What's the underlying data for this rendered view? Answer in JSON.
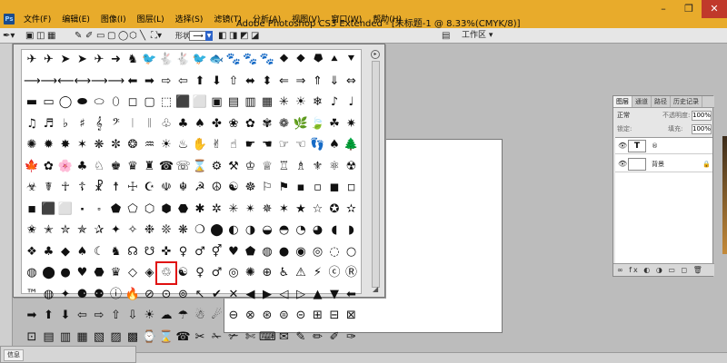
{
  "window": {
    "title": "Adobe Photoshop CS3 Extended - [未标题-1 @ 8.33%(CMYK/8)]",
    "app_icon_label": "Ps",
    "minimize": "–",
    "restore": "❐",
    "close": "✕"
  },
  "menu": [
    "文件(F)",
    "编辑(E)",
    "图像(I)",
    "图层(L)",
    "选择(S)",
    "滤镜(T)",
    "分析(A)",
    "视图(V)",
    "窗口(W)",
    "帮助(H)"
  ],
  "options_bar": {
    "style_label": "形状:",
    "style_value": "⟶",
    "workspace_label": "工作区 ▾"
  },
  "shape_picker": {
    "menu_glyph": "▸",
    "selected_index": 208,
    "shapes": [
      "✈",
      "✈",
      "➤",
      "➤",
      "✈",
      "➜",
      "♞",
      "🐦",
      "🐇",
      "🐇",
      "🐦",
      "🐟",
      "🐾",
      "🐾",
      "🐾",
      "⯁",
      "⯁",
      "⯂",
      "⯅",
      "⯆",
      "⟶",
      "⟶",
      "⟵",
      "⟷",
      "⟶",
      "⟶",
      "⬅",
      "➡",
      "⇨",
      "⇦",
      "⬆",
      "⬇",
      "⇧",
      "⬌",
      "⬍",
      "⇐",
      "⇒",
      "⇑",
      "⇓",
      "⇔",
      "▬",
      "▭",
      "◯",
      "⬬",
      "⬭",
      "⬯",
      "◻",
      "▢",
      "⬚",
      "⬛",
      "⬜",
      "▣",
      "▤",
      "▥",
      "▦",
      "✳",
      "☀",
      "❄",
      "♪",
      "♩",
      "♫",
      "♬",
      "♭",
      "♯",
      "𝄞",
      "𝄢",
      "𝄀",
      "𝄁",
      "♧",
      "♣",
      "♠",
      "✤",
      "❀",
      "✿",
      "✾",
      "❁",
      "🌿",
      "🍃",
      "☘",
      "✷",
      "✺",
      "✹",
      "✸",
      "✶",
      "❋",
      "✼",
      "❂",
      "♒",
      "☀",
      "♨",
      "✋",
      "✌",
      "☝",
      "☛",
      "☚",
      "☞",
      "☜",
      "👣",
      "♠",
      "🌲",
      "🍁",
      "✿",
      "🌸",
      "♣",
      "♘",
      "♚",
      "♛",
      "♜",
      "☎",
      "☏",
      "⌛",
      "⚙",
      "⚒",
      "♔",
      "♕",
      "♖",
      "♗",
      "⚜",
      "⚛",
      "☢",
      "☣",
      "☤",
      "☥",
      "☦",
      "☧",
      "☨",
      "☩",
      "☪",
      "☫",
      "☬",
      "☭",
      "☮",
      "☯",
      "☸",
      "⚐",
      "⚑",
      "▪",
      "▫",
      "◼",
      "◽",
      "◾",
      "⬛",
      "⬜",
      "⬝",
      "⬞",
      "⬟",
      "⬠",
      "⬡",
      "⬢",
      "⬣",
      "✱",
      "✲",
      "✳",
      "✴",
      "✵",
      "✶",
      "★",
      "☆",
      "✪",
      "✫",
      "✬",
      "✭",
      "✮",
      "✯",
      "✰",
      "✦",
      "✧",
      "❉",
      "❊",
      "❋",
      "❍",
      "⬤",
      "◐",
      "◑",
      "◒",
      "◓",
      "◔",
      "◕",
      "◖",
      "◗",
      "❖",
      "♣",
      "◆",
      "♠",
      "☾",
      "♞",
      "☊",
      "☋",
      "✜",
      "♀",
      "♂",
      "⚥",
      "♥",
      "⬟",
      "◍",
      "●",
      "◉",
      "◎",
      "◌",
      "○",
      "◍",
      "⬤",
      "●",
      "♥",
      "⬣",
      "♛",
      "◇",
      "◈",
      "♲",
      "☯",
      "♀",
      "♂",
      "◎",
      "✺",
      "⊕",
      "♿",
      "⚠",
      "⚡",
      "ⓒ",
      "Ⓡ",
      "™",
      "◍",
      "✦",
      "⚈",
      "⚉",
      "ⓘ",
      "🔥",
      "⊘",
      "⊙",
      "⊚",
      "↖",
      "✔",
      "✕",
      "◀",
      "▶",
      "◁",
      "▷",
      "▲",
      "▼",
      "⬅",
      "➡",
      "⬆",
      "⬇",
      "⇦",
      "⇨",
      "⇧",
      "⇩",
      "☀",
      "☁",
      "☂",
      "☃",
      "☄",
      "⊖",
      "⊗",
      "⊛",
      "⊜",
      "⊝",
      "⊞",
      "⊟",
      "⊠",
      "⊡",
      "▤",
      "▥",
      "▦",
      "▧",
      "▨",
      "▩",
      "⌚",
      "⌛",
      "☎",
      "✂",
      "✁",
      "✃",
      "✄",
      "⌨",
      "✉",
      "✎",
      "✏",
      "✐",
      "✑"
    ]
  },
  "layers_panel": {
    "tabs": [
      "图层",
      "通道",
      "路径",
      "历史记录"
    ],
    "blend_mode": "正常",
    "opacity_label": "不透明度:",
    "opacity_value": "100%",
    "lock_label": "锁定:",
    "fill_label": "填充:",
    "fill_value": "100%",
    "layers": [
      {
        "name": "®",
        "thumb": "T",
        "locked": false
      },
      {
        "name": "背景",
        "thumb": "",
        "locked": true
      }
    ],
    "footer_icons": "∞ fx ◐ ◑ ▭ ◻ 🗑"
  },
  "info_panel": {
    "tab": "信息"
  },
  "colors": {
    "titlebar": "#e8ab2b",
    "selection": "#e01010",
    "workspace": "#bcbcbc"
  }
}
